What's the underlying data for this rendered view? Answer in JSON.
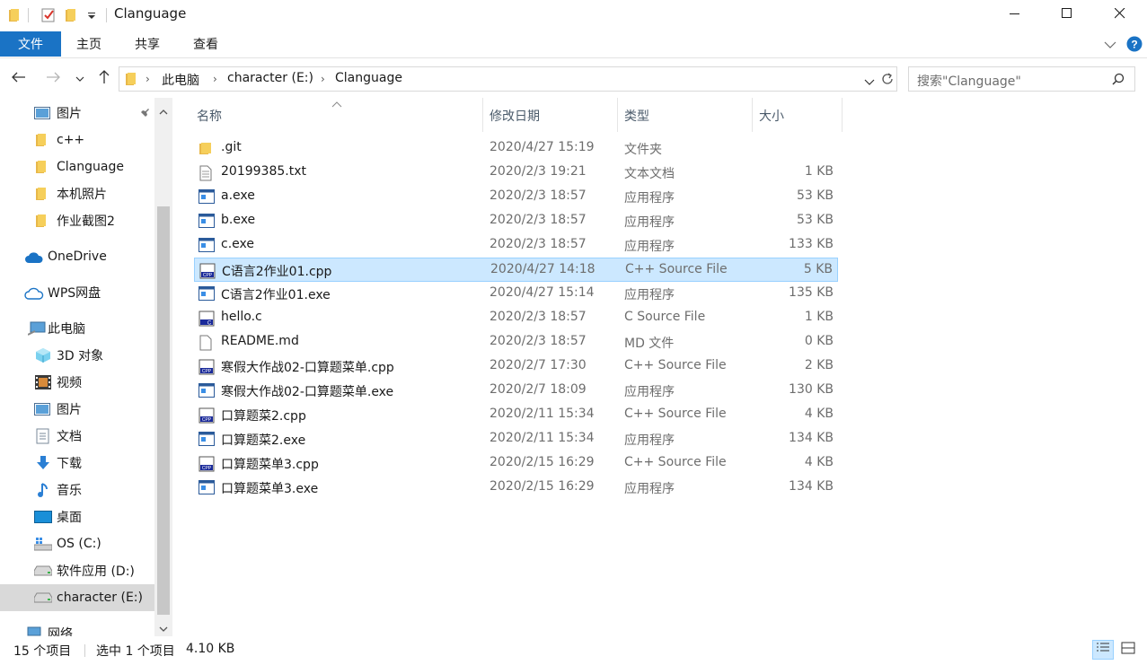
{
  "window": {
    "title": "Clanguage",
    "minimize_icon": "minimize-icon",
    "maximize_icon": "maximize-icon",
    "close_icon": "close-icon"
  },
  "ribbon": {
    "file_label": "文件",
    "tabs": [
      "主页",
      "共享",
      "查看"
    ],
    "accent": "#1a73c5"
  },
  "address": {
    "crumbs": [
      "此电脑",
      "character (E:)",
      "Clanguage"
    ]
  },
  "search": {
    "placeholder": "搜索\"Clanguage\""
  },
  "sidebar": {
    "items": [
      {
        "label": "图片",
        "icon": "pictures-icon"
      },
      {
        "label": "c++",
        "icon": "folder-icon"
      },
      {
        "label": "Clanguage",
        "icon": "folder-icon"
      },
      {
        "label": "本机照片",
        "icon": "folder-icon"
      },
      {
        "label": "作业截图2",
        "icon": "folder-icon"
      },
      {
        "label": "OneDrive",
        "icon": "onedrive-cloud-icon"
      },
      {
        "label": "WPS网盘",
        "icon": "wps-cloud-icon"
      },
      {
        "label": "此电脑",
        "icon": "this-pc-icon"
      },
      {
        "label": "3D 对象",
        "icon": "3d-objects-icon"
      },
      {
        "label": "视频",
        "icon": "videos-icon"
      },
      {
        "label": "图片",
        "icon": "pictures-icon"
      },
      {
        "label": "文档",
        "icon": "documents-icon"
      },
      {
        "label": "下载",
        "icon": "downloads-icon"
      },
      {
        "label": "音乐",
        "icon": "music-icon"
      },
      {
        "label": "桌面",
        "icon": "desktop-icon"
      },
      {
        "label": "OS (C:)",
        "icon": "os-drive-icon"
      },
      {
        "label": "软件应用 (D:)",
        "icon": "drive-icon"
      },
      {
        "label": "character (E:)",
        "icon": "drive-icon"
      },
      {
        "label": "网络",
        "icon": "network-icon"
      }
    ]
  },
  "columns": {
    "name": "名称",
    "date": "修改日期",
    "type": "类型",
    "size": "大小"
  },
  "files": [
    {
      "name": ".git",
      "date": "2020/4/27 15:19",
      "type": "文件夹",
      "size": "",
      "icon": "folder-icon"
    },
    {
      "name": "20199385.txt",
      "date": "2020/2/3 19:21",
      "type": "文本文档",
      "size": "1 KB",
      "icon": "text-file-icon"
    },
    {
      "name": "a.exe",
      "date": "2020/2/3 18:57",
      "type": "应用程序",
      "size": "53 KB",
      "icon": "exe-icon"
    },
    {
      "name": "b.exe",
      "date": "2020/2/3 18:57",
      "type": "应用程序",
      "size": "53 KB",
      "icon": "exe-icon"
    },
    {
      "name": "c.exe",
      "date": "2020/2/3 18:57",
      "type": "应用程序",
      "size": "133 KB",
      "icon": "exe-icon"
    },
    {
      "name": "C语言2作业01.cpp",
      "date": "2020/4/27 14:18",
      "type": "C++ Source File",
      "size": "5 KB",
      "icon": "cpp-file-icon",
      "selected": true
    },
    {
      "name": "C语言2作业01.exe",
      "date": "2020/4/27 15:14",
      "type": "应用程序",
      "size": "135 KB",
      "icon": "exe-icon"
    },
    {
      "name": "hello.c",
      "date": "2020/2/3 18:57",
      "type": "C Source File",
      "size": "1 KB",
      "icon": "c-file-icon"
    },
    {
      "name": "README.md",
      "date": "2020/2/3 18:57",
      "type": "MD 文件",
      "size": "0 KB",
      "icon": "blank-file-icon"
    },
    {
      "name": "寒假大作战02-口算题菜单.cpp",
      "date": "2020/2/7 17:30",
      "type": "C++ Source File",
      "size": "2 KB",
      "icon": "cpp-file-icon"
    },
    {
      "name": "寒假大作战02-口算题菜单.exe",
      "date": "2020/2/7 18:09",
      "type": "应用程序",
      "size": "130 KB",
      "icon": "exe-icon"
    },
    {
      "name": "口算题菜2.cpp",
      "date": "2020/2/11 15:34",
      "type": "C++ Source File",
      "size": "4 KB",
      "icon": "cpp-file-icon"
    },
    {
      "name": "口算题菜2.exe",
      "date": "2020/2/11 15:34",
      "type": "应用程序",
      "size": "134 KB",
      "icon": "exe-icon"
    },
    {
      "name": "口算题菜单3.cpp",
      "date": "2020/2/15 16:29",
      "type": "C++ Source File",
      "size": "4 KB",
      "icon": "cpp-file-icon"
    },
    {
      "name": "口算题菜单3.exe",
      "date": "2020/2/15 16:29",
      "type": "应用程序",
      "size": "134 KB",
      "icon": "exe-icon"
    }
  ],
  "status": {
    "item_count": "15 个项目",
    "selected": "选中 1 个项目",
    "selected_size": "4.10 KB"
  }
}
